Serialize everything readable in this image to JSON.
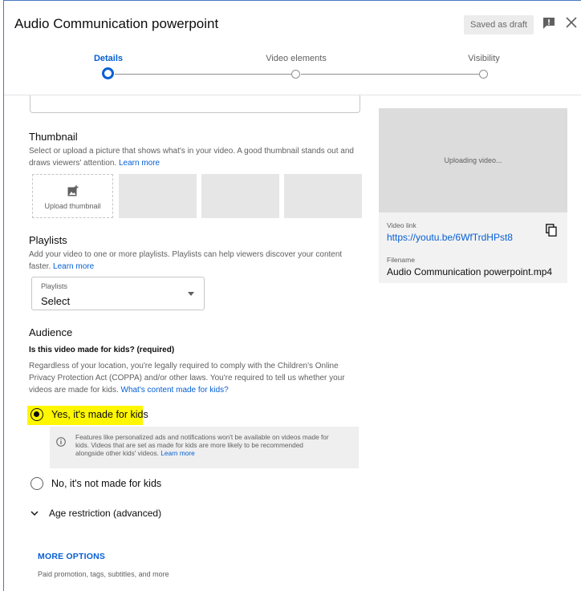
{
  "header": {
    "title": "Audio Communication powerpoint",
    "draft_label": "Saved as draft"
  },
  "stepper": {
    "steps": [
      {
        "label": "Details",
        "active": true
      },
      {
        "label": "Video elements",
        "active": false
      },
      {
        "label": "Visibility",
        "active": false
      }
    ]
  },
  "thumbnail": {
    "title": "Thumbnail",
    "description": "Select or upload a picture that shows what's in your video. A good thumbnail stands out and draws viewers' attention.",
    "learn_more": "Learn more",
    "upload_label": "Upload thumbnail"
  },
  "playlists": {
    "title": "Playlists",
    "description": "Add your video to one or more playlists. Playlists can help viewers discover your content faster.",
    "learn_more": "Learn more",
    "select_label": "Playlists",
    "select_value": "Select"
  },
  "audience": {
    "title": "Audience",
    "question": "Is this video made for kids? (required)",
    "description": "Regardless of your location, you're legally required to comply with the Children's Online Privacy Protection Act (COPPA) and/or other laws. You're required to tell us whether your videos are made for kids.",
    "content_link": "What's content made for kids?",
    "option_yes": "Yes, it's made for kids",
    "option_no": "No, it's not made for kids",
    "info_text": "Features like personalized ads and notifications won't be available on videos made for kids. Videos that are set as made for kids are more likely to be recommended alongside other kids' videos.",
    "info_link": "Learn more",
    "age_restriction": "Age restriction (advanced)"
  },
  "more_options": {
    "label": "MORE OPTIONS",
    "description": "Paid promotion, tags, subtitles, and more"
  },
  "preview": {
    "uploading": "Uploading video...",
    "video_link_label": "Video link",
    "video_link": "https://youtu.be/6WfTrdHPst8",
    "filename_label": "Filename",
    "filename": "Audio Communication powerpoint.mp4"
  },
  "colors": {
    "accent": "#065fd4",
    "highlight": "#fff700"
  }
}
